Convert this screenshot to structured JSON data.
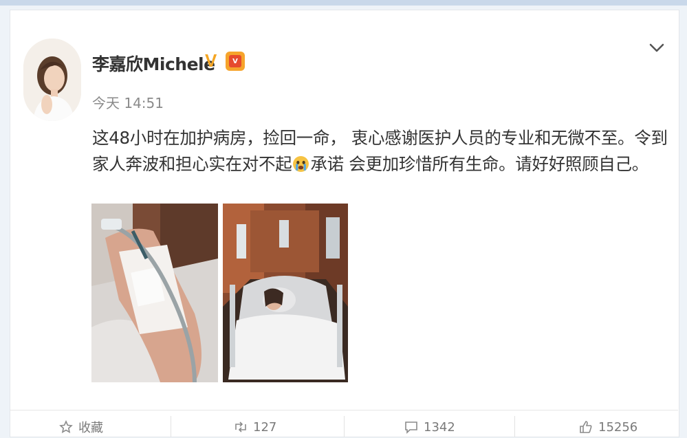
{
  "post": {
    "author": "李嘉欣Michele",
    "verified_mark": "V",
    "level_badge": "V",
    "timestamp": "今天 14:51",
    "text_part1": "这48小时在加护病房，捡回一命， 衷心感谢医护人员的专业和无微不至。令到家人奔波和担心实在对不起",
    "text_part2": "承诺 会更加珍惜所有生命。请好好照顾自己。",
    "emoji": "crying-face-emoji",
    "photos": [
      "hand-with-iv-photo",
      "hospital-bed-photo"
    ]
  },
  "actions": [
    {
      "icon": "share-icon",
      "label": "收藏"
    },
    {
      "icon": "repost-icon",
      "label": "127"
    },
    {
      "icon": "comment-icon",
      "label": "1342"
    },
    {
      "icon": "like-icon",
      "label": "15256"
    }
  ],
  "colors": {
    "background": "#eef3f8",
    "verified": "#f5a623",
    "badge": "#f6a42c"
  }
}
